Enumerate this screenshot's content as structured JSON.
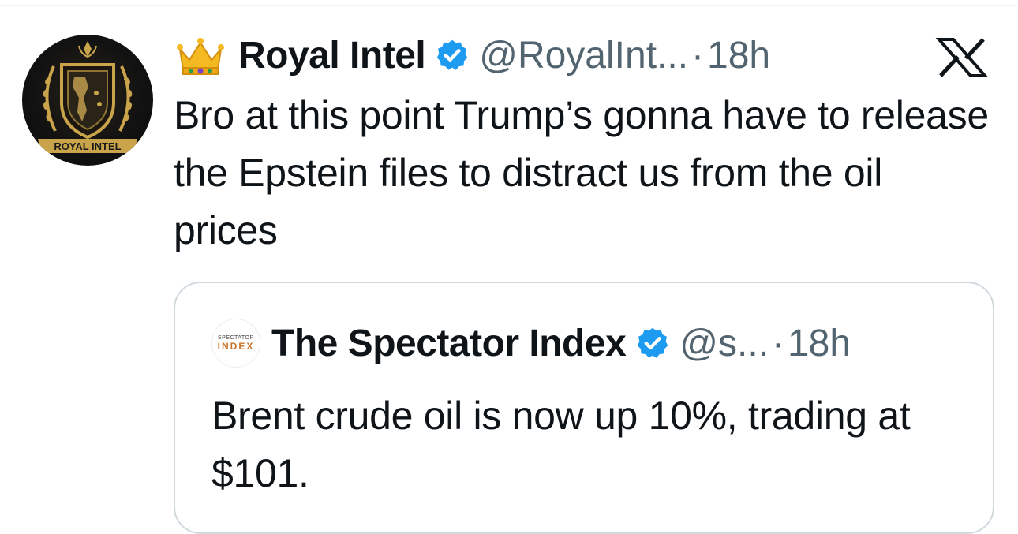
{
  "tweet": {
    "author": {
      "name": "Royal Intel",
      "handle": "@RoyalInt...",
      "avatar_text": "ROYAL INTEL",
      "emoji": "crown-icon",
      "verified": true
    },
    "separator": "·",
    "time": "18h",
    "text": "Bro at this point Trump’s gonna have to release the Epstein files to distract us from the oil prices",
    "platform_icon": "x-logo-icon"
  },
  "quote": {
    "author": {
      "name": "The Spectator Index",
      "handle": "@s...",
      "avatar_top": "SPECTATOR",
      "avatar_bottom": "INDEX",
      "verified": true
    },
    "separator": "·",
    "time": "18h",
    "text": "Brent crude oil is now up 10%, trading at $101."
  },
  "colors": {
    "verified": "#1d9bf0",
    "text": "#0f1419",
    "secondary": "#536471",
    "border": "#cfd9de",
    "avatar_gold": "#c9a44a"
  }
}
